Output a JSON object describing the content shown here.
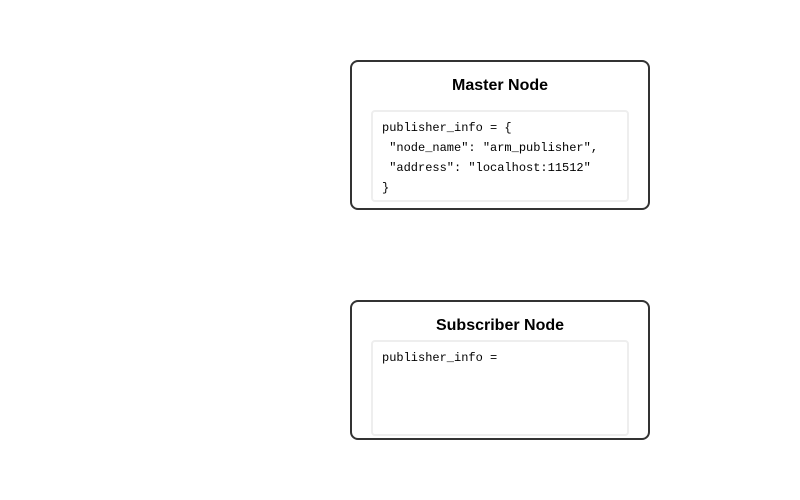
{
  "master": {
    "title": "Master Node",
    "code_lines": [
      "publisher_info = {",
      " \"node_name\": \"arm_publisher\",",
      " \"address\": \"localhost:11512\"",
      "}"
    ]
  },
  "subscriber": {
    "title": "Subscriber Node",
    "code_lines": [
      "publisher_info ="
    ]
  }
}
